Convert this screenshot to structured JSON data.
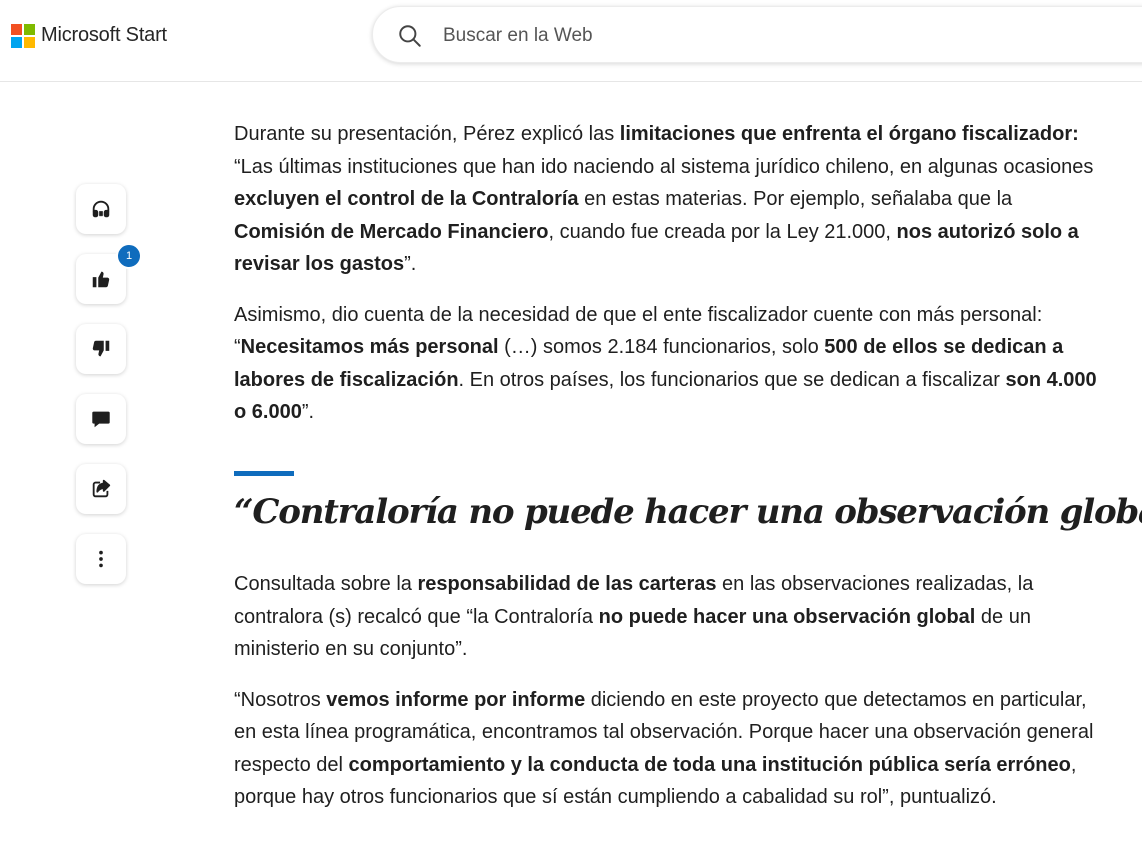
{
  "header": {
    "brand": "Microsoft Start",
    "logo_colors": [
      "#f25022",
      "#7fba00",
      "#00a4ef",
      "#ffb900"
    ],
    "search_placeholder": "Buscar en la Web"
  },
  "rail": {
    "buttons": [
      {
        "name": "listen",
        "icon": "headphones-icon"
      },
      {
        "name": "like",
        "icon": "thumbs-up-icon",
        "badge": "1"
      },
      {
        "name": "dislike",
        "icon": "thumbs-down-icon"
      },
      {
        "name": "comment",
        "icon": "comment-icon"
      },
      {
        "name": "share",
        "icon": "share-icon"
      },
      {
        "name": "more",
        "icon": "more-vertical-icon"
      }
    ]
  },
  "article": {
    "p1": {
      "t1": "Durante su presentación, Pérez explicó las ",
      "b1": "limitaciones que enfrenta el órgano fiscalizador:",
      "t2": " “Las últimas instituciones que han ido naciendo al sistema jurídico chileno, en algunas ocasiones ",
      "b2": "excluyen el control de la Contraloría",
      "t3": " en estas materias. Por ejemplo, señalaba que la ",
      "b3": "Comisión de Mercado Financiero",
      "t4": ", cuando fue creada por la Ley 21.000, ",
      "b4": "nos autorizó solo a revisar los gastos",
      "t5": "”."
    },
    "p2": {
      "t1": "Asimismo, dio cuenta de la necesidad de que el ente fiscalizador cuente con más personal: “",
      "b1": "Necesitamos más personal",
      "t2": " (…) somos 2.184 funcionarios, solo ",
      "b2": "500 de ellos se dedican a labores de fiscalización",
      "t3": ". En otros países, los funcionarios que se dedican a fiscalizar ",
      "b3": "son 4.000 o 6.000",
      "t4": "”."
    },
    "section_title": "“Contraloría no puede hacer una observación global”",
    "p3": {
      "t1": "Consultada sobre la ",
      "b1": "responsabilidad de las carteras",
      "t2": " en las observaciones realizadas, la contralora (s) recalcó que “la Contraloría ",
      "b2": "no puede hacer una observación global",
      "t3": " de un ministerio en su conjunto”."
    },
    "p4": {
      "t1": "“Nosotros ",
      "b1": "vemos informe por informe",
      "t2": " diciendo en este proyecto que detectamos en particular, en esta línea programática, encontramos tal observación. Porque hacer una observación general respecto del ",
      "b2": "comportamiento y la conducta de toda una institución pública sería erróneo",
      "t3": ", porque hay otros funcionarios que sí están cumpliendo a cabalidad su rol”, puntualizó."
    },
    "accent_color": "#0f6cbd"
  }
}
